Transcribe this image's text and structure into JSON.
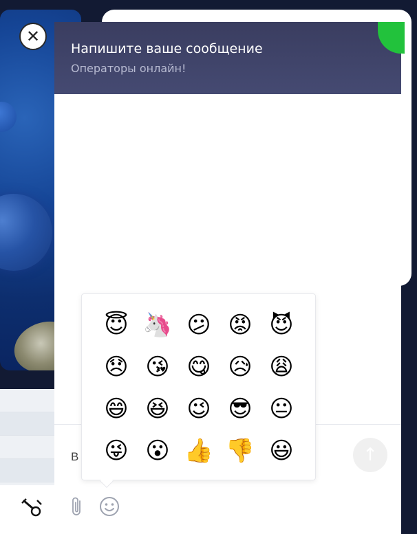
{
  "chat": {
    "title": "Напишите ваше сообщение",
    "subtitle": "Операторы онлайн!",
    "input_value": "В",
    "close_glyph": "✕",
    "send_glyph": "↑"
  },
  "emoji_picker": {
    "emojis": [
      "😇",
      "🦄",
      "😕",
      "😡",
      "😈",
      "😞",
      "😘",
      "😋",
      "😥",
      "😩",
      "😄",
      "😆",
      "😉",
      "😎",
      "😐",
      "😜",
      "😮",
      "👍",
      "👎",
      "😃"
    ]
  },
  "colors": {
    "header_bg": "#3f4369",
    "online_green": "#22c23c",
    "background": "#121a33"
  },
  "icons": {
    "attach": "paperclip-icon",
    "emoji": "smiley-icon",
    "send": "arrow-up-icon",
    "close": "close-icon"
  }
}
